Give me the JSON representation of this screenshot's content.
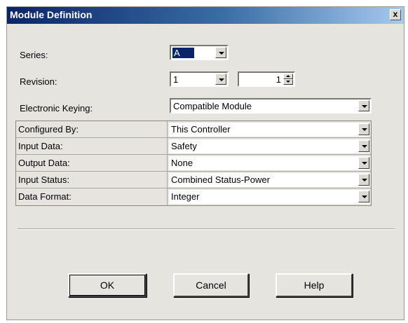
{
  "window": {
    "title": "Module Definition",
    "close_label": "x"
  },
  "series": {
    "label": "Series:",
    "value": "A"
  },
  "revision": {
    "label": "Revision:",
    "major": "1",
    "minor": "1"
  },
  "keying": {
    "label": "Electronic Keying:",
    "value": "Compatible Module"
  },
  "grid": {
    "rows": [
      {
        "label": "Configured By:",
        "value": "This Controller"
      },
      {
        "label": "Input Data:",
        "value": "Safety"
      },
      {
        "label": "Output Data:",
        "value": "None"
      },
      {
        "label": "Input Status:",
        "value": "Combined Status-Power"
      },
      {
        "label": "Data Format:",
        "value": "Integer"
      }
    ]
  },
  "buttons": {
    "ok": "OK",
    "cancel": "Cancel",
    "help": "Help"
  },
  "icons": {
    "close": "close-icon",
    "dropdown": "chevron-down-icon",
    "spin_up": "spin-up-icon",
    "spin_down": "spin-down-icon"
  },
  "colors": {
    "title_bar": "#0a246a",
    "dialog_bg": "#e6e4df",
    "selection": "#0a246a"
  }
}
